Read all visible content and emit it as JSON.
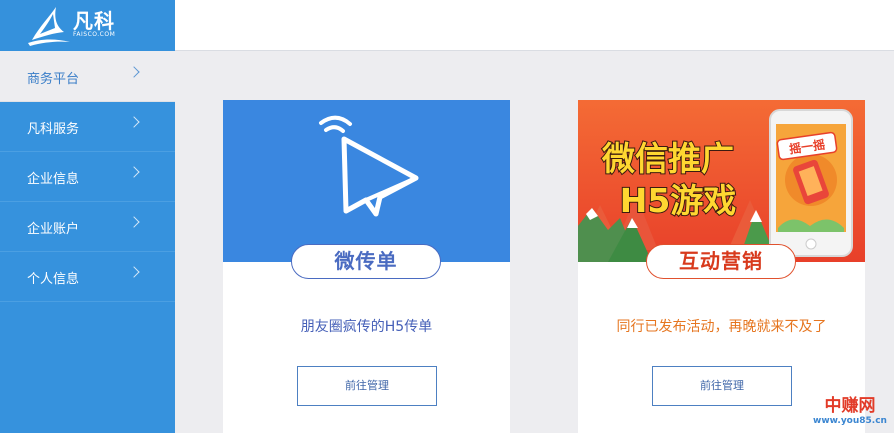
{
  "brand": {
    "name": "凡科",
    "sub": "FAISCO.COM"
  },
  "sidebar": {
    "items": [
      {
        "label": "商务平台",
        "active": true
      },
      {
        "label": "凡科服务",
        "active": false
      },
      {
        "label": "企业信息",
        "active": false
      },
      {
        "label": "企业账户",
        "active": false
      },
      {
        "label": "个人信息",
        "active": false
      }
    ]
  },
  "cards": [
    {
      "title": "微传单",
      "description": "朋友圈疯传的H5传单",
      "button": "前往管理",
      "icon": "paper-plane-icon",
      "accent": "#3a87e0"
    },
    {
      "title": "互动营销",
      "description": "同行已发布活动，再晚就来不及了",
      "button": "前往管理",
      "banner_line1": "微信推广",
      "banner_line2": "H5游戏",
      "phone_badge": "摇一摇",
      "accent": "#e8402a"
    }
  ],
  "watermark": {
    "title": "中赚网",
    "url": "www.you85.cn"
  }
}
